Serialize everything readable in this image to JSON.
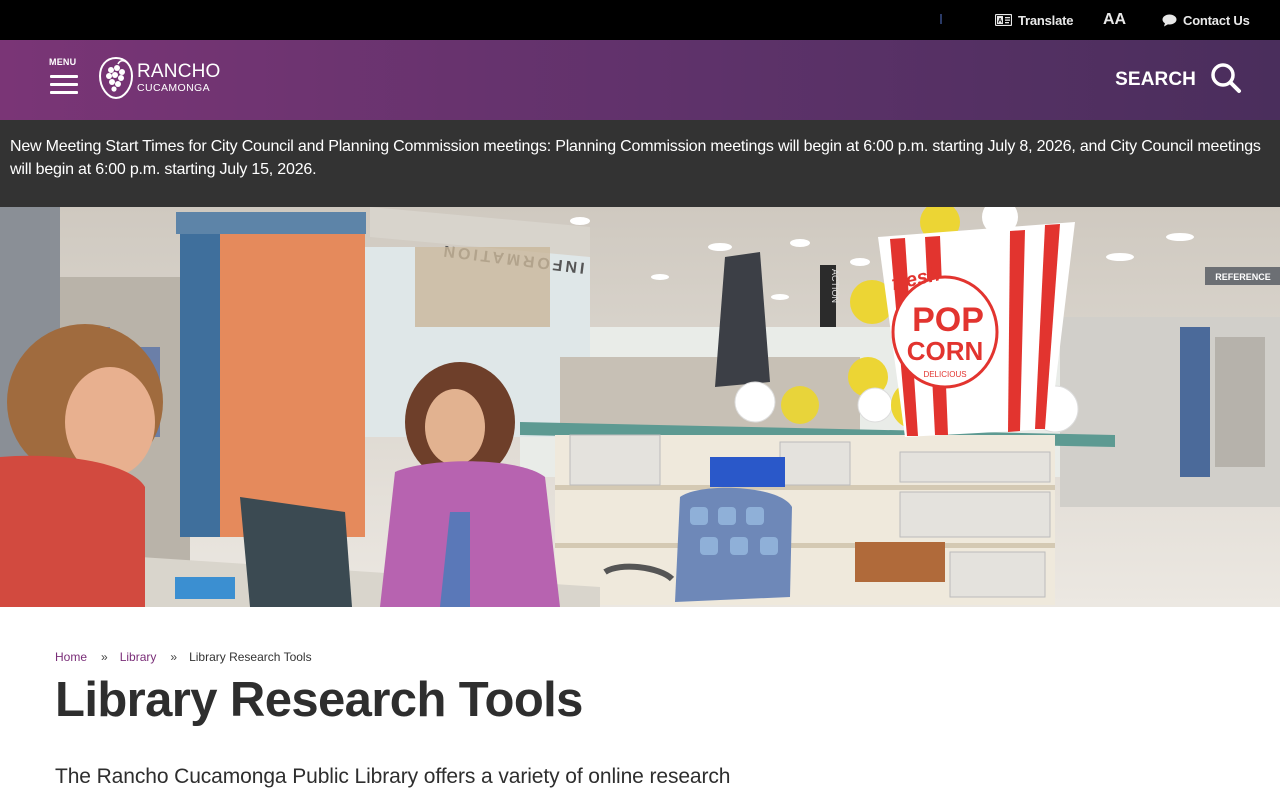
{
  "utility": {
    "translate_label": "Translate",
    "text_size_label": "AA",
    "contact_label": "Contact Us"
  },
  "header": {
    "menu_label": "MENU",
    "logo_line1": "RANCHO",
    "logo_line2": "CUCAMONGA",
    "search_label": "SEARCH"
  },
  "alert": {
    "text": "New Meeting Start Times for City Council and Planning Commission meetings: Planning Commission meetings will begin at 6:00 p.m. starting July 8, 2026, and City Council meetings will begin at 6:00 p.m. starting July 15, 2026."
  },
  "hero": {
    "sign_information": "INFORMATION",
    "sign_action": "ACTION",
    "sign_reference": "REFERENCE",
    "popcorn_fresh": "fresh",
    "popcorn_pop": "POP",
    "popcorn_corn": "CORN",
    "popcorn_delicious": "DELICIOUS"
  },
  "breadcrumb": {
    "items": [
      {
        "label": "Home"
      },
      {
        "label": "Library"
      }
    ],
    "separator": "»",
    "current": "Library Research Tools"
  },
  "page": {
    "title": "Library Research Tools",
    "intro": "The Rancho Cucamonga Public Library offers a variety of online research"
  },
  "colors": {
    "utility_bg": "#000000",
    "header_start": "#7a3576",
    "header_end": "#4a2e5c",
    "alert_bg": "#333333",
    "link": "#7a2e78"
  },
  "icons": [
    "translate-icon",
    "text-size-icon",
    "chat-bubble-icon",
    "menu-icon",
    "logo-icon",
    "search-icon"
  ]
}
